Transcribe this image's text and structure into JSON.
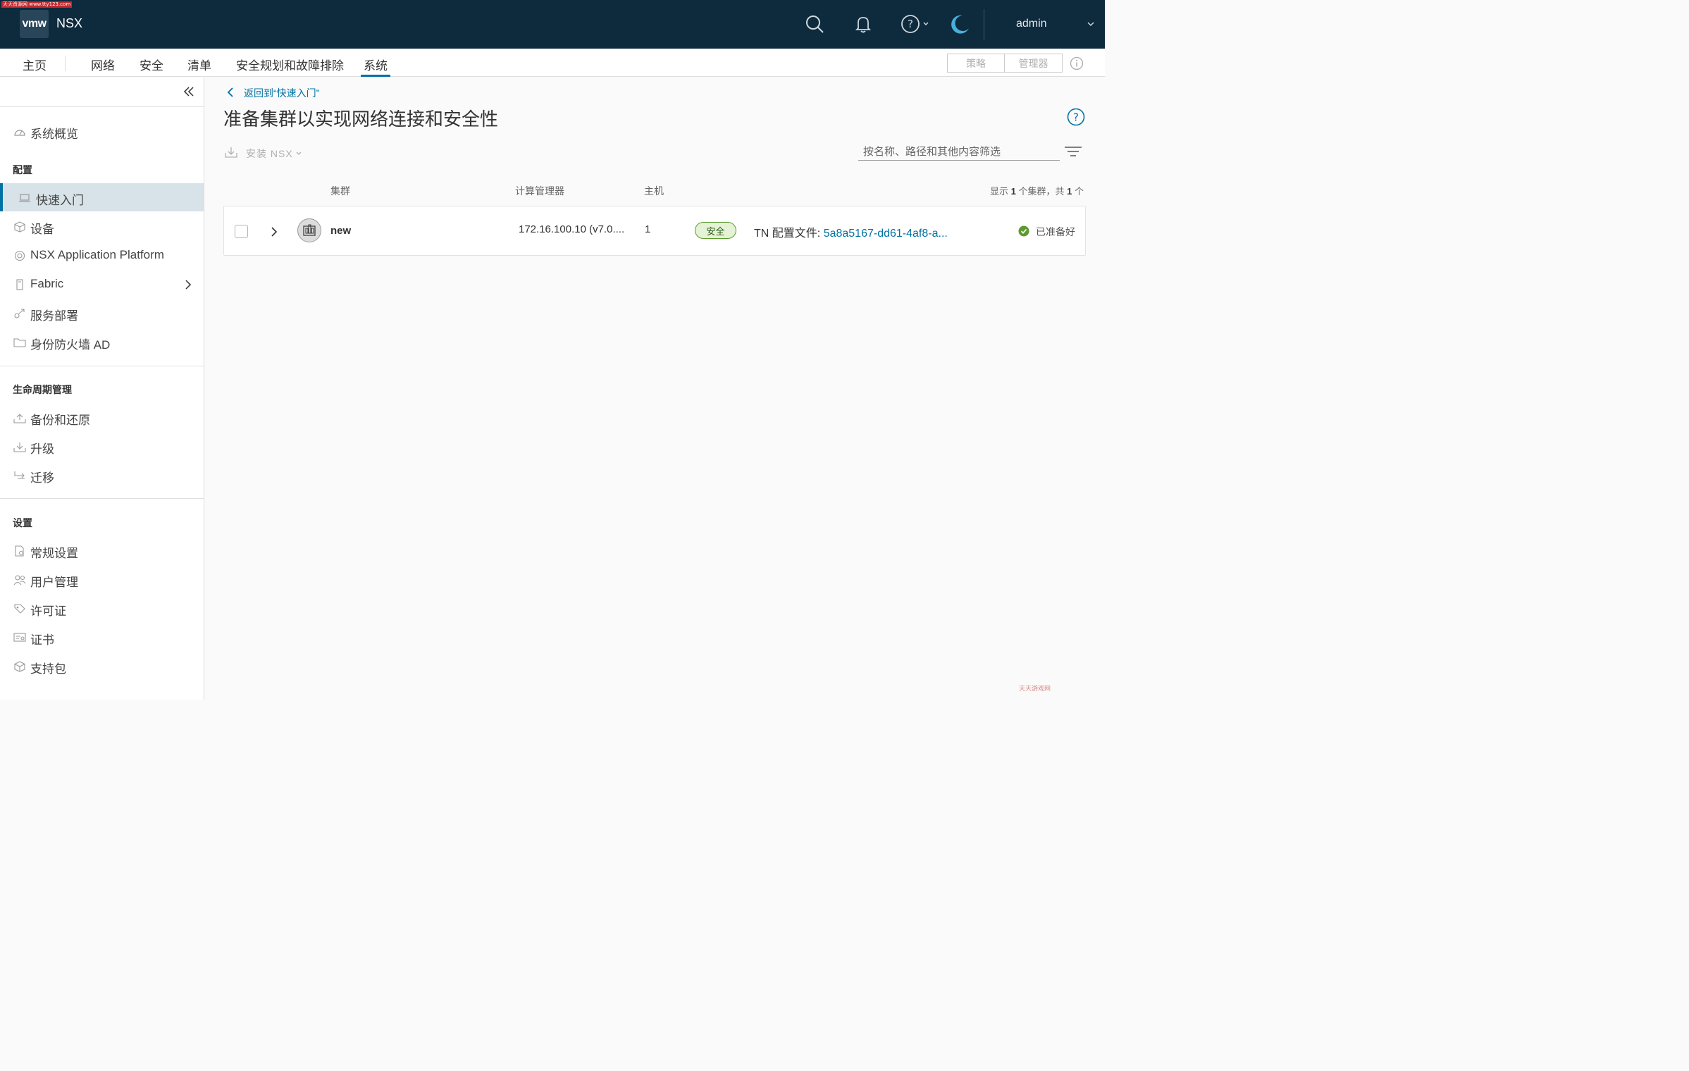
{
  "watermark_top": "天天资源网 www.tty123.com",
  "header": {
    "logo": "vmw",
    "product": "NSX",
    "user": "admin",
    "icons": [
      "search-icon",
      "bell-icon",
      "help-icon",
      "moon-icon"
    ]
  },
  "nav": {
    "tabs": [
      "主页",
      "网络",
      "安全",
      "清单",
      "安全规划和故障排除",
      "系统"
    ],
    "active_tab": "系统",
    "mode_policy": "策略",
    "mode_manager": "管理器"
  },
  "sidebar": {
    "overview": "系统概览",
    "section_config": "配置",
    "config_items": [
      "快速入门",
      "设备",
      "NSX Application Platform",
      "Fabric",
      "服务部署",
      "身份防火墙 AD"
    ],
    "section_lifecycle": "生命周期管理",
    "lifecycle_items": [
      "备份和还原",
      "升级",
      "迁移"
    ],
    "section_settings": "设置",
    "settings_items": [
      "常规设置",
      "用户管理",
      "许可证",
      "证书",
      "支持包"
    ]
  },
  "main": {
    "back_link": "返回到“快速入门”",
    "title": "准备集群以实现网络连接和安全性",
    "install_label": "安装 NSX",
    "search_placeholder": "按名称、路径和其他内容筛选",
    "columns": {
      "cluster": "集群",
      "compute_manager": "计算管理器",
      "hosts": "主机"
    },
    "count_prefix": "显示",
    "count_shown": "1",
    "count_mid": "个集群，共",
    "count_total": "1",
    "count_suffix": "个",
    "row": {
      "name": "new",
      "compute_manager": "172.16.100.10 (v7.0....",
      "hosts": "1",
      "badge": "安全",
      "tn_label": "TN 配置文件:",
      "tn_value": "5a8a5167-dd61-4af8-a...",
      "status": "已准备好"
    }
  },
  "watermark_bottom": "天天游戏网",
  "colors": {
    "header_bg": "#0e2a3d",
    "accent": "#0072a3",
    "success": "#5c9a2d"
  }
}
